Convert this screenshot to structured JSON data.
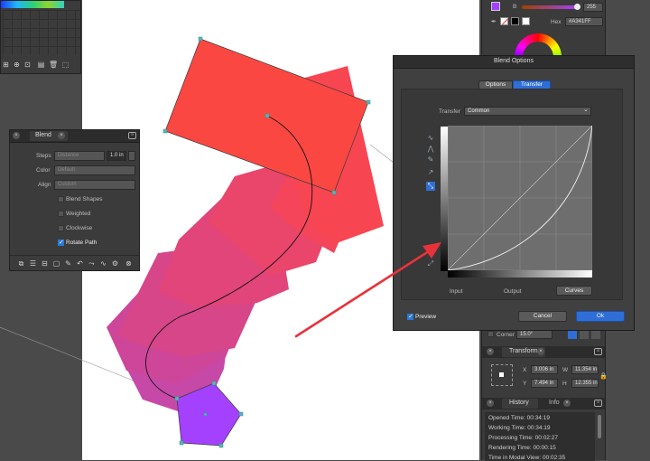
{
  "blend_panel": {
    "title": "Blend",
    "steps_label": "Steps",
    "steps_value": "Distance",
    "distance_value": "1.0 in",
    "color_label": "Color",
    "color_value": "Default",
    "align_label": "Align",
    "align_value": "Custom",
    "options": [
      {
        "label": "Blend Shapes",
        "checked": false
      },
      {
        "label": "Weighted",
        "checked": false
      },
      {
        "label": "Clockwise",
        "checked": false
      },
      {
        "label": "Rotate Path",
        "checked": true
      }
    ]
  },
  "color_panel": {
    "channel_label": "B",
    "channel_value": "255",
    "hex_label": "Hex",
    "hex_value": "#A341FF"
  },
  "dialog": {
    "title": "Blend Options",
    "tabs": [
      {
        "label": "Options",
        "active": false
      },
      {
        "label": "Transfer",
        "active": true
      }
    ],
    "transfer_label": "Transfer",
    "transfer_value": "Common",
    "input_label": "Input",
    "output_label": "Output",
    "curves_label": "Curves",
    "preview_label": "Preview",
    "cancel_label": "Cancel",
    "ok_label": "Ok"
  },
  "corner_row": {
    "label": "Corner",
    "value": "15.0°"
  },
  "transform_panel": {
    "title": "Transform",
    "x_label": "X",
    "x_value": "3.006 in",
    "y_label": "Y",
    "y_value": "7.494 in",
    "w_label": "W",
    "w_value": "11.354 in",
    "h_label": "H",
    "h_value": "12.355 in"
  },
  "history_panel": {
    "tabs": [
      {
        "label": "History",
        "active": true
      },
      {
        "label": "Info",
        "active": false
      }
    ],
    "lines": [
      "Opened Time: 00:34:19",
      "Working Time: 00:34:19",
      "Processing Time: 00:02:27",
      "Rendering Time: 00:00:15",
      "Time in Modal View: 00:02:35"
    ]
  },
  "colors": {
    "shape_start": "#fb4742",
    "shape_end": "#a341ff",
    "accent_blue": "#2f6ed6",
    "arrow_red": "#e8323a"
  }
}
